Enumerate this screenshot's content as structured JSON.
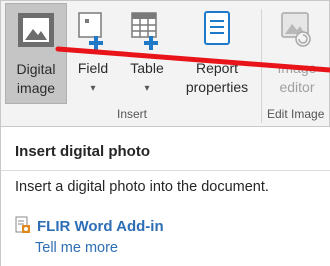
{
  "ribbon": {
    "insert_group": {
      "label": "Insert",
      "buttons": [
        {
          "label1": "Digital",
          "label2": "image",
          "icon": "image-icon",
          "state": "pressed"
        },
        {
          "label1": "Field",
          "caret": "▾",
          "icon": "insert-field-icon"
        },
        {
          "label1": "Table",
          "caret": "▾",
          "icon": "insert-table-icon"
        },
        {
          "label1": "Report",
          "label2": "properties",
          "icon": "report-properties-icon"
        }
      ]
    },
    "edit_group": {
      "label": "Edit Image",
      "buttons": [
        {
          "label1": "Image",
          "label2": "editor",
          "icon": "image-editor-icon",
          "state": "disabled"
        }
      ]
    }
  },
  "tooltip": {
    "title": "Insert digital photo",
    "description": "Insert a digital photo into the document.",
    "addin_name": "FLIR Word Add-in",
    "addin_icon": "addin-icon",
    "link": "Tell me more"
  },
  "colors": {
    "accent_blue": "#2e6eb5",
    "annotation_red": "#e8141a",
    "ribbon_bg": "#f3f3f3",
    "pressed_bg": "#c5c5c5"
  }
}
